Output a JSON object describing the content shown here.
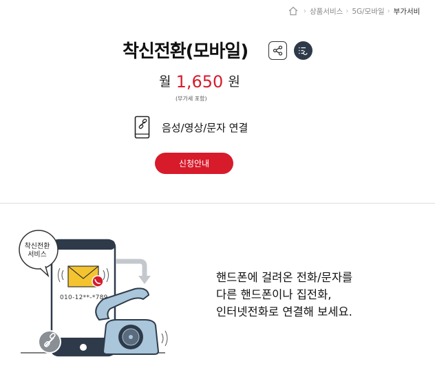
{
  "breadcrumb": {
    "items": [
      "상품서비스",
      "5G/모바일",
      "부가서비"
    ],
    "home_icon": "home-icon",
    "separator_icon": "chevron-right-icon"
  },
  "product": {
    "title": "착신전환(모바일)",
    "share_icon": "share-icon",
    "list_icon": "list-icon",
    "price_prefix": "월",
    "price_amount": "1,650",
    "price_suffix": "원",
    "vat_note": "(부가세 포함)",
    "feature_icon": "phone-link-icon",
    "feature_label": "음성/영상/문자 연결",
    "apply_label": "신청안내"
  },
  "intro": {
    "bubble_label_1": "착신전환",
    "bubble_label_2": "서비스",
    "phone_number": "010-12**-*789",
    "description_lines": [
      "핸드폰에 걸려온 전화/문자를",
      "다른 핸드폰이나 집전화,",
      "인터넷전화로 연결해 보세요."
    ]
  },
  "colors": {
    "accent": "#d71b2b",
    "navy": "#2e3a4a",
    "illustration_blue": "#a9c6da"
  }
}
